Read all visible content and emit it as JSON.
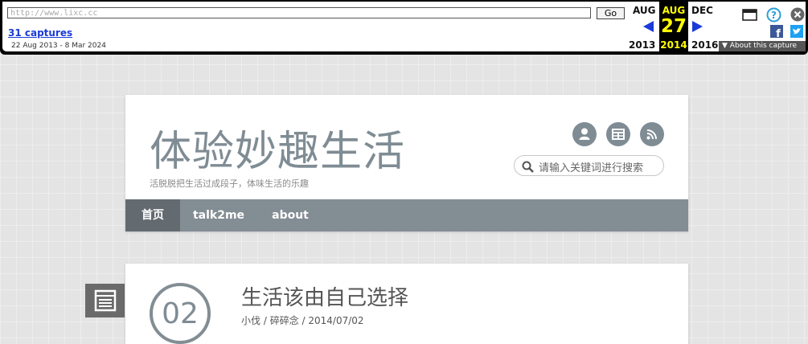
{
  "wayback": {
    "url_value": "http://www.lixc.cc",
    "go_label": "Go",
    "captures_label": "31 captures",
    "date_range": "22 Aug 2013 - 8 Mar 2024",
    "prev_month": "AUG",
    "prev_year": "2013",
    "cur_month": "AUG",
    "cur_day": "27",
    "cur_year": "2014",
    "next_month": "DEC",
    "next_year": "2016",
    "about_label": "▼ About this capture",
    "accent": "#1a3bd8",
    "highlight": "#ffff00"
  },
  "site": {
    "title": "体验妙趣生活",
    "tagline": "活脱脱把生活过成段子，体味生活的乐趣",
    "header_icons": [
      "user-icon",
      "grid-icon",
      "rss-icon"
    ],
    "search_placeholder": "请输入关键词进行搜索"
  },
  "nav": {
    "items": [
      {
        "label": "首页"
      },
      {
        "label": "talk2me"
      },
      {
        "label": "about"
      }
    ]
  },
  "post": {
    "day": "02",
    "title": "生活该由自己选择",
    "author": "小伐",
    "sep": " / ",
    "category": "碎碎念",
    "date": "2014/07/02"
  }
}
